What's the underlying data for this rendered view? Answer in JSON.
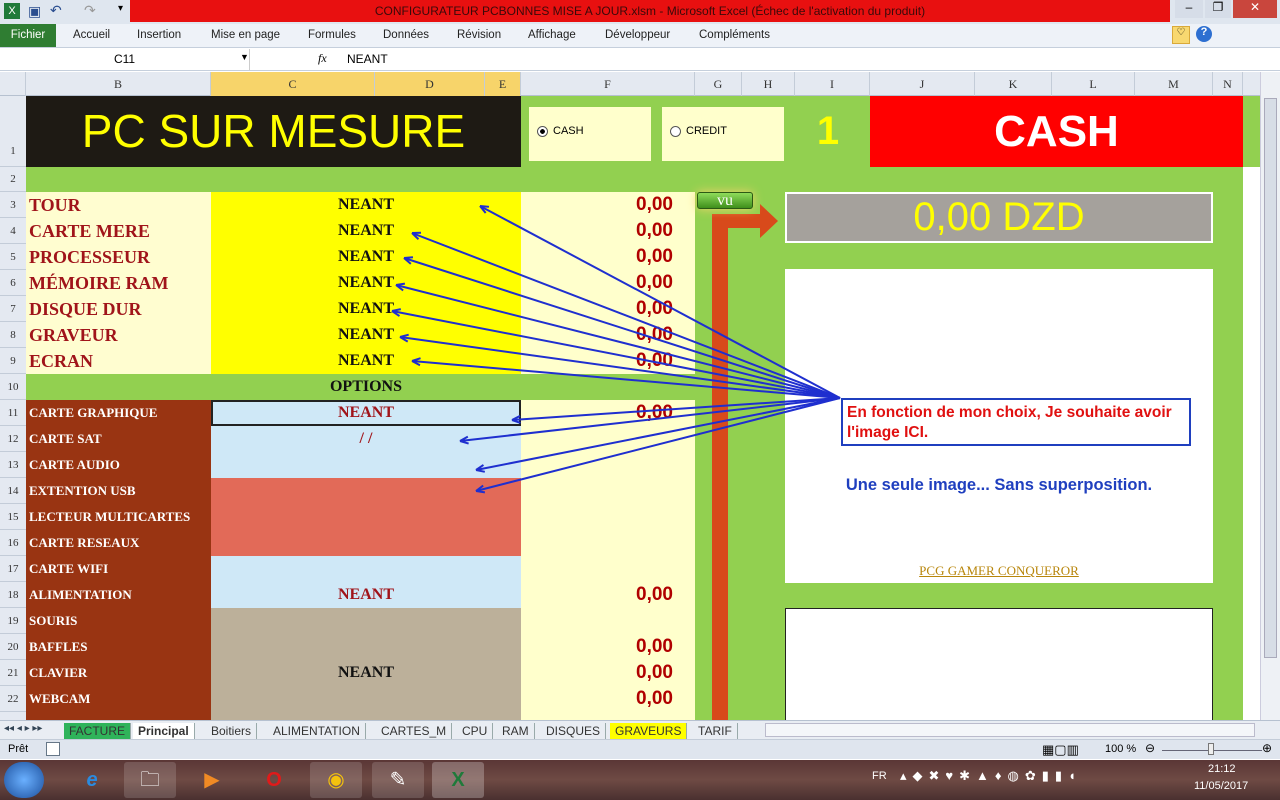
{
  "window": {
    "title": "CONFIGURATEUR PCBONNES  MISE A JOUR.xlsm  -  Microsoft Excel (Échec de l'activation du produit)"
  },
  "ribbon": {
    "file": "Fichier",
    "tabs": [
      "Accueil",
      "Insertion",
      "Mise en page",
      "Formules",
      "Données",
      "Révision",
      "Affichage",
      "Développeur",
      "Compléments"
    ]
  },
  "formula_bar": {
    "name_box": "C11",
    "fx": "fx",
    "value": "NEANT"
  },
  "columns": [
    "B",
    "C",
    "D",
    "E",
    "F",
    "G",
    "H",
    "I",
    "J",
    "K",
    "L",
    "M",
    "N"
  ],
  "header": {
    "title": "PC SUR MESURE",
    "option_cash": "CASH",
    "option_credit": "CREDIT",
    "option_selected": "CASH",
    "index": "1",
    "mode": "CASH",
    "vu_button": "vu",
    "total": "0,00 DZD"
  },
  "components": [
    {
      "row": "3",
      "label": "TOUR",
      "value": "NEANT",
      "price": "0,00"
    },
    {
      "row": "4",
      "label": "CARTE MERE",
      "value": "NEANT",
      "price": "0,00"
    },
    {
      "row": "5",
      "label": "PROCESSEUR",
      "value": "NEANT",
      "price": "0,00"
    },
    {
      "row": "6",
      "label": "MÉMOIRE RAM",
      "value": "NEANT",
      "price": "0,00"
    },
    {
      "row": "7",
      "label": "DISQUE DUR",
      "value": "NEANT",
      "price": "0,00"
    },
    {
      "row": "8",
      "label": "GRAVEUR",
      "value": "NEANT",
      "price": "0,00"
    },
    {
      "row": "9",
      "label": "ECRAN",
      "value": "NEANT",
      "price": "0,00"
    }
  ],
  "options_title": "OPTIONS",
  "options": [
    {
      "row": "11",
      "label": "CARTE GRAPHIQUE",
      "value": "NEANT",
      "price": "0,00",
      "bg": "#cfe8f7",
      "vcolor": "#a0141a"
    },
    {
      "row": "12",
      "label": "CARTE SAT",
      "value": "/ /",
      "price": "",
      "bg": "#cfe8f7",
      "vcolor": "#a0141a"
    },
    {
      "row": "13",
      "label": "CARTE AUDIO",
      "value": "",
      "price": "",
      "bg": "#cfe8f7",
      "vcolor": "#a0141a"
    },
    {
      "row": "14",
      "label": "EXTENTION USB",
      "value": "",
      "price": "",
      "bg": "#e26a58",
      "vcolor": "#a0141a"
    },
    {
      "row": "15",
      "label": "LECTEUR MULTICARTES",
      "value": "",
      "price": "",
      "bg": "#e26a58",
      "vcolor": "#a0141a"
    },
    {
      "row": "16",
      "label": "CARTE RESEAUX",
      "value": "",
      "price": "",
      "bg": "#e26a58",
      "vcolor": "#a0141a"
    },
    {
      "row": "17",
      "label": "CARTE WIFI",
      "value": "",
      "price": "",
      "bg": "#cfe8f7",
      "vcolor": "#a0141a"
    },
    {
      "row": "18",
      "label": "ALIMENTATION",
      "value": "NEANT",
      "price": "0,00",
      "bg": "#cfe8f7",
      "vcolor": "#a0141a"
    },
    {
      "row": "19",
      "label": "SOURIS",
      "value": "",
      "price": "",
      "bg": "#bcb09a",
      "vcolor": "#111"
    },
    {
      "row": "20",
      "label": "BAFFLES",
      "value": "",
      "price": "0,00",
      "bg": "#bcb09a",
      "vcolor": "#111"
    },
    {
      "row": "21",
      "label": "CLAVIER",
      "value": "NEANT",
      "price": "0,00",
      "bg": "#bcb09a",
      "vcolor": "#111"
    },
    {
      "row": "22",
      "label": "WEBCAM",
      "value": "",
      "price": "0,00",
      "bg": "#bcb09a",
      "vcolor": "#111"
    }
  ],
  "row_numbers": [
    "1",
    "2",
    "10"
  ],
  "annotations": {
    "callout": "En fonction de mon choix, Je souhaite avoir l'image ICI.",
    "note": "Une seule image... Sans superposition.",
    "link": "PCG GAMER CONQUEROR"
  },
  "sheets": {
    "tabs": [
      "FACTURE",
      "Principal",
      "Boitiers",
      "ALIMENTATION",
      "CARTES_M",
      "CPU",
      "RAM",
      "DISQUES",
      "GRAVEURS",
      "TARIF"
    ],
    "active": "Principal"
  },
  "status": {
    "ready": "Prêt",
    "zoom": "100 %"
  },
  "taskbar": {
    "lang": "FR",
    "time": "21:12",
    "date": "11/05/2017"
  },
  "colors": {
    "green": "#92d050",
    "red": "#ff0000",
    "yellow": "#ffff00",
    "brown": "#993412",
    "arrow": "#1f2fcf"
  }
}
